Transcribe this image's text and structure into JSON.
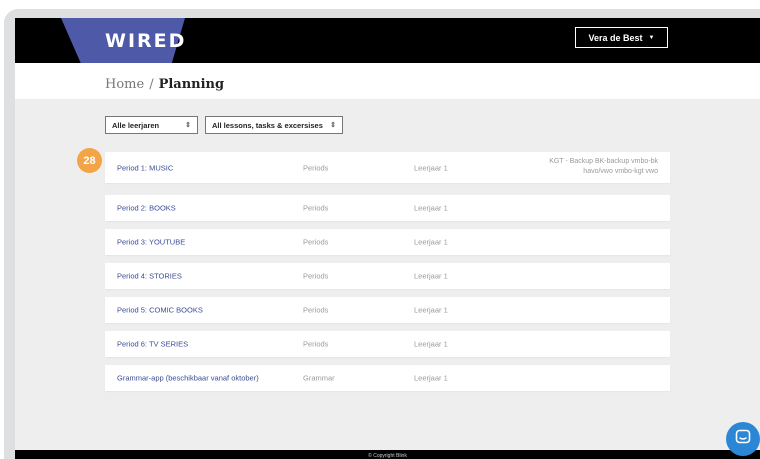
{
  "app": {
    "logo": "WIRED"
  },
  "header": {
    "user_name": "Vera de Best",
    "user_caret": "▼"
  },
  "breadcrumb": {
    "home": "Home",
    "separator": "/",
    "current": "Planning"
  },
  "filters": {
    "grade": {
      "selected": "Alle leerjaren"
    },
    "content": {
      "selected": "All lessons, tasks & excersises"
    }
  },
  "badge": "28",
  "rows": [
    {
      "title": "Period 1: MUSIC",
      "type": "Periods",
      "level": "Leerjaar 1",
      "groups": "KGT - Backup  BK-backup  vmbo-bk  havo/vwo  vmbo-kgt  vwo"
    },
    {
      "title": "Period 2: BOOKS",
      "type": "Periods",
      "level": "Leerjaar 1"
    },
    {
      "title": "Period 3: YOUTUBE",
      "type": "Periods",
      "level": "Leerjaar 1"
    },
    {
      "title": "Period 4: STORIES",
      "type": "Periods",
      "level": "Leerjaar 1"
    },
    {
      "title": "Period 5: COMIC BOOKS",
      "type": "Periods",
      "level": "Leerjaar 1"
    },
    {
      "title": "Period 6: TV SERIES",
      "type": "Periods",
      "level": "Leerjaar 1"
    },
    {
      "title": "Grammar-app (beschikbaar vanaf oktober)",
      "type": "Grammar",
      "level": "Leerjaar 1"
    }
  ],
  "footer": {
    "copyright": "© Copyright Blink"
  },
  "colors": {
    "brand_blue": "#4e59a8",
    "badge_orange": "#f2a446",
    "chat_blue": "#2b86d6",
    "link_blue": "#3a4c94"
  },
  "icons": {
    "chat": "chat-icon",
    "select": "select-arrows-icon",
    "caret": "caret-down-icon"
  }
}
